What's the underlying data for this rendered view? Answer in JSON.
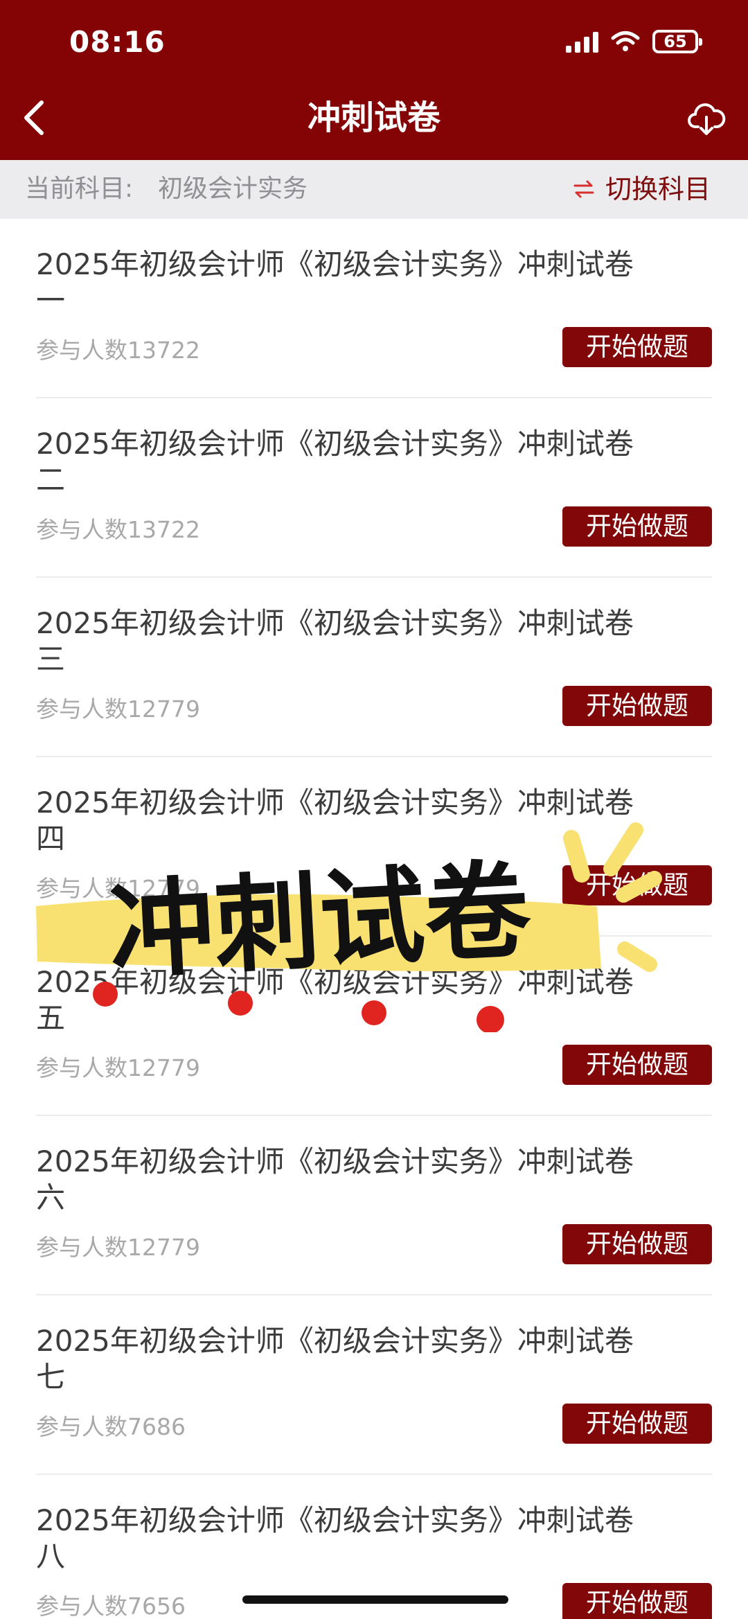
{
  "status_bar": {
    "time": "08:16",
    "battery": "65"
  },
  "nav": {
    "title": "冲刺试卷",
    "back_icon": "chevron-left-icon",
    "download_icon": "cloud-download-icon"
  },
  "subject": {
    "label": "当前科目:",
    "value": "初级会计实务",
    "switch_label": "切换科目",
    "switch_icon": "swap-arrows-icon"
  },
  "papers": [
    {
      "title": "2025年初级会计师《初级会计实务》冲刺试卷一",
      "participants": "参与人数13722",
      "button": "开始做题"
    },
    {
      "title": "2025年初级会计师《初级会计实务》冲刺试卷二",
      "participants": "参与人数13722",
      "button": "开始做题"
    },
    {
      "title": "2025年初级会计师《初级会计实务》冲刺试卷三",
      "participants": "参与人数12779",
      "button": "开始做题"
    },
    {
      "title": "2025年初级会计师《初级会计实务》冲刺试卷四",
      "participants": "参与人数12779",
      "button": "开始做题"
    },
    {
      "title": "2025年初级会计师《初级会计实务》冲刺试卷五",
      "participants": "参与人数12779",
      "button": "开始做题"
    },
    {
      "title": "2025年初级会计师《初级会计实务》冲刺试卷六",
      "participants": "参与人数12779",
      "button": "开始做题"
    },
    {
      "title": "2025年初级会计师《初级会计实务》冲刺试卷七",
      "participants": "参与人数7686",
      "button": "开始做题"
    },
    {
      "title": "2025年初级会计师《初级会计实务》冲刺试卷八",
      "participants": "参与人数7656",
      "button": "开始做题"
    }
  ],
  "overlay": {
    "text": "冲刺试卷"
  },
  "colors": {
    "brand": "#840405",
    "button": "#810709",
    "subject_bar": "#ececef",
    "highlight": "#f9e171",
    "dot": "#e0241f"
  }
}
